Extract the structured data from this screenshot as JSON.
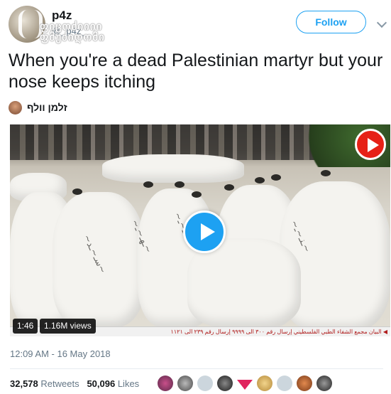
{
  "author": {
    "display_name": "p4z",
    "handle": "@_p4z_",
    "watermark": "ფიცოძიიიი\nფმუძიღომი"
  },
  "header": {
    "follow_label": "Follow"
  },
  "tweet": {
    "text": "When you're a dead Palestinian martyr but your nose keeps itching",
    "translator_name": "זלמן וולף",
    "timestamp": "12:09 AM - 16 May 2018"
  },
  "video": {
    "duration": "1:46",
    "views": "1.16M views",
    "ticker_text": "◀ البيان  مجمع الشفاء الطبي الفلسطيني  إرسال رقم ٣٠٠ الى ٩٩٩٩  إرسال رقم ٢٣٩ الى ١١٢١"
  },
  "stats": {
    "retweets_count": "32,578",
    "retweets_label": "Retweets",
    "likes_count": "50,096",
    "likes_label": "Likes"
  },
  "colors": {
    "accent": "#1da1f2",
    "text": "#14171a",
    "muted": "#657786",
    "youtube_red": "#e62117"
  },
  "icons": [
    "chevron-down-icon",
    "play-icon",
    "youtube-icon",
    "heart-icon"
  ]
}
